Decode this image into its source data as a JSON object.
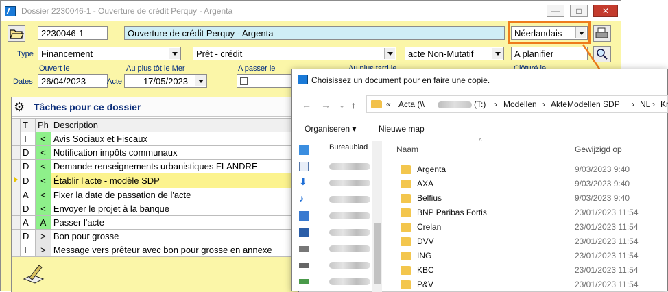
{
  "main_window": {
    "title": "Dossier 2230046-1 - Ouverture de crédit Perquy - Argenta",
    "controls": {
      "minimize": "—",
      "maximize": "□",
      "close": "✕"
    },
    "dossier_number": "2230046-1",
    "dossier_title": "Ouverture de crédit  Perquy - Argenta",
    "language": "Néerlandais",
    "type_label": "Type",
    "type_value": "Financement",
    "subtype_value": "Prêt - crédit",
    "act_kind_value": "acte Non-Mutatif",
    "planning_value": "A planifier",
    "dates_label": "Dates",
    "opened_label": "Ouvert le",
    "opened_value": "26/04/2023",
    "earliest_label": "Au plus tôt le Mer",
    "act_label": "Acte",
    "act_date_value": "17/05/2023",
    "to_pass_label": "A passer le",
    "latest_label": "Au plus tard le",
    "closed_label": "Clôturé le"
  },
  "tasks": {
    "title": "Tâches pour ce dossier",
    "columns": [
      "T",
      "Ph",
      "Description"
    ],
    "rows": [
      {
        "t": "T",
        "ph": "<",
        "desc": "Avis Sociaux et Fiscaux"
      },
      {
        "t": "D",
        "ph": "<",
        "desc": "Notification impôts communaux"
      },
      {
        "t": "D",
        "ph": "<",
        "desc": "Demande renseignements urbanistiques FLANDRE"
      },
      {
        "t": "D",
        "ph": "<",
        "desc": "Établir l'acte - modèle SDP"
      },
      {
        "t": "A",
        "ph": "<",
        "desc": "Fixer la date de passation de l'acte"
      },
      {
        "t": "D",
        "ph": "<",
        "desc": "Envoyer le projet à la banque"
      },
      {
        "t": "A",
        "ph": "A",
        "desc": "Passer l'acte"
      },
      {
        "t": "D",
        "ph": ">",
        "desc": "Bon pour grosse"
      },
      {
        "t": "T",
        "ph": ">",
        "desc": "Message vers prêteur avec bon pour grosse en annexe"
      }
    ]
  },
  "dialog": {
    "title": "Choisissez un document pour en faire une copie.",
    "path": {
      "prefix": "«",
      "root": "Acta (\\\\",
      "drive": "(T:)",
      "segments": [
        "Modellen",
        "AkteModellen SDP",
        "NL",
        "Krediet"
      ]
    },
    "organize_label": "Organiseren ▾",
    "new_folder_label": "Nieuwe map",
    "sidebar_first": "Bureaublad",
    "col_name": "Naam",
    "col_modified": "Gewijzigd op",
    "files": [
      {
        "name": "Argenta",
        "date": "9/03/2023 9:40"
      },
      {
        "name": "AXA",
        "date": "9/03/2023 9:40"
      },
      {
        "name": "Belfius",
        "date": "9/03/2023 9:40"
      },
      {
        "name": "BNP Paribas Fortis",
        "date": "23/01/2023 11:54"
      },
      {
        "name": "Crelan",
        "date": "23/01/2023 11:54"
      },
      {
        "name": "DVV",
        "date": "23/01/2023 11:54"
      },
      {
        "name": "ING",
        "date": "23/01/2023 11:54"
      },
      {
        "name": "KBC",
        "date": "23/01/2023 11:54"
      },
      {
        "name": "P&V",
        "date": "23/01/2023 11:54"
      }
    ]
  },
  "colors": {
    "highlight": "#ee7c1c",
    "panel": "#fbf6a8",
    "phase": "#8ef08a"
  }
}
